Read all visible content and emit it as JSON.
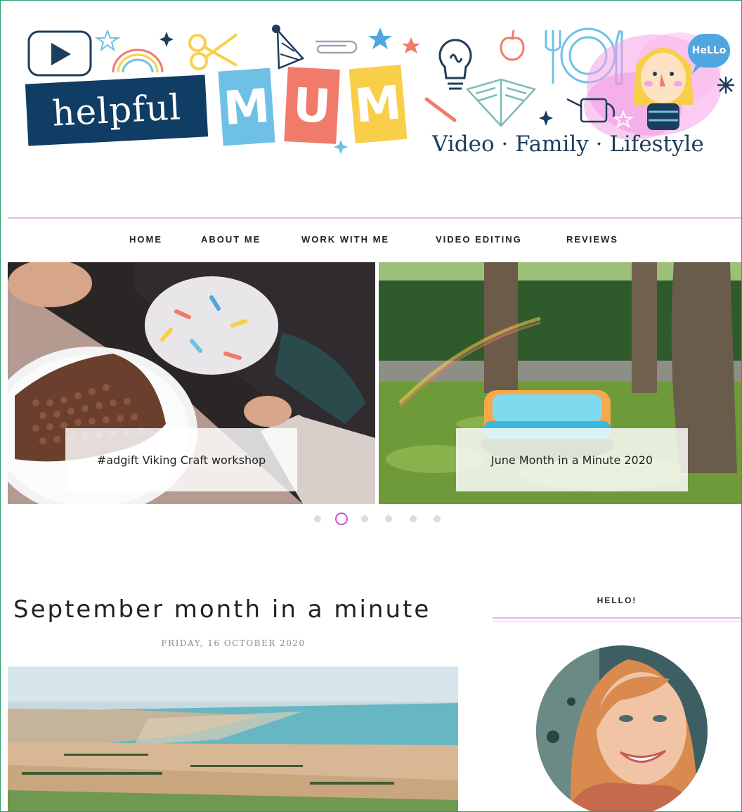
{
  "header": {
    "logo_word": "helpful",
    "logo_letters": [
      "M",
      "U",
      "M"
    ],
    "tagline": "Video · Family · Lifestyle",
    "bubble_text": "HeLLo"
  },
  "nav": {
    "items": [
      {
        "label": "HOME"
      },
      {
        "label": "ABOUT ME"
      },
      {
        "label": "WORK WITH ME"
      },
      {
        "label": "VIDEO EDITING"
      },
      {
        "label": "REVIEWS"
      }
    ]
  },
  "slider": {
    "slides": [
      {
        "caption": "#adgift Viking Craft workshop"
      },
      {
        "caption": "June Month in a Minute 2020"
      }
    ],
    "dot_count": 6,
    "active_dot": 2
  },
  "post": {
    "title": "September month in a minute",
    "date": "FRIDAY, 16 OCTOBER 2020"
  },
  "sidebar": {
    "heading": "HELLO!"
  },
  "colors": {
    "accent_pink": "#d04ad6",
    "divider_pink": "#e6b8ea",
    "logo_navy": "#0f3d63",
    "tile_blue": "#6ec1e4",
    "tile_coral": "#f07b6b",
    "tile_yellow": "#f9cf4a",
    "frame_green": "#2f9e6a"
  },
  "icons": [
    "play-icon",
    "rainbow-icon",
    "scissors-icon",
    "party-hat-icon",
    "paperclip-icon",
    "star-icon",
    "lightbulb-icon",
    "apple-icon",
    "book-icon",
    "pencil-icon",
    "plate-icon",
    "fork-icon",
    "knife-icon",
    "watering-can-icon",
    "mascot-illustration"
  ]
}
